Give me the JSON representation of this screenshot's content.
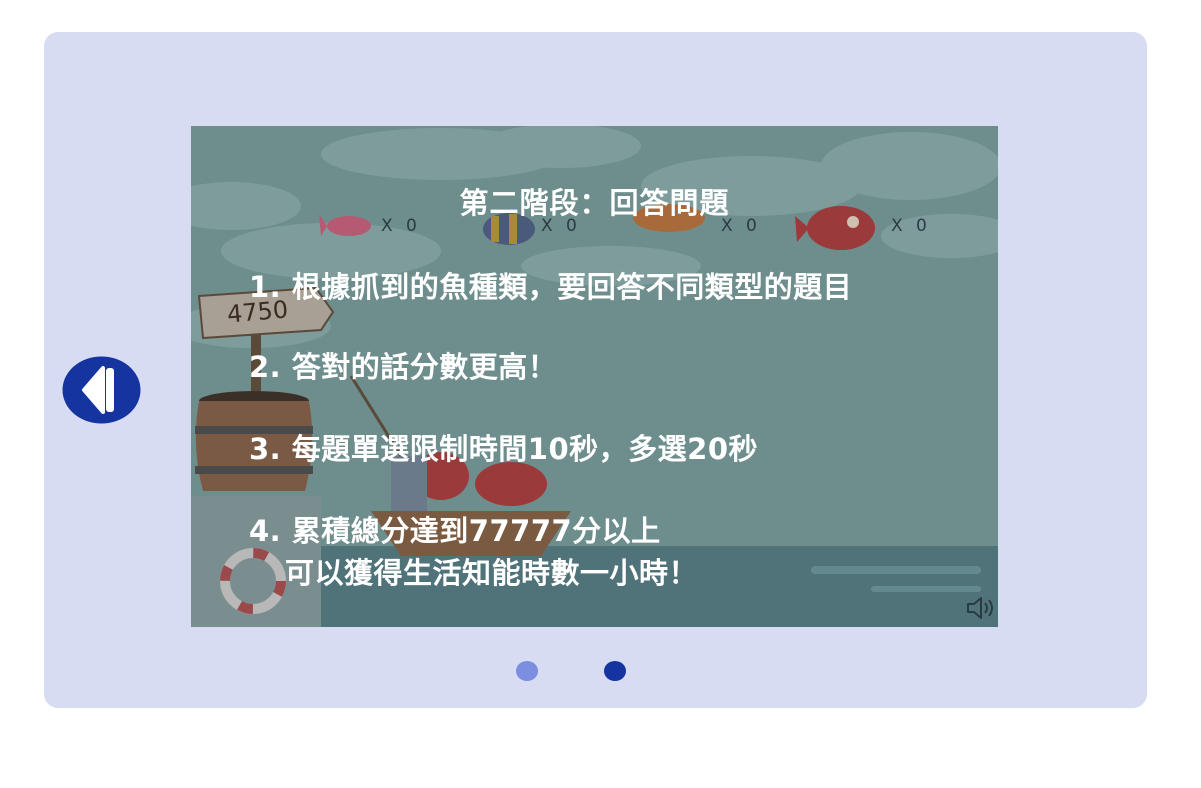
{
  "slide": {
    "title": "第二階段：回答問題",
    "rules": [
      "1. 根據抓到的魚種類，要回答不同類型的題目",
      "2. 答對的話分數更高！",
      "3. 每題單選限制時間10秒，多選20秒",
      "4. 累積總分達到77777分以上",
      "可以獲得生活知能時數一小時！"
    ]
  },
  "game": {
    "score": "4750",
    "fish_counts": [
      "X 0",
      "X 0",
      "X 0",
      "X 0"
    ]
  },
  "icons": {
    "prev": "triangle-left-icon",
    "sound": "speaker-icon"
  },
  "pager": {
    "total_pages": 2,
    "current_page": 2
  },
  "colors": {
    "panel_bg": "#d8dcf3",
    "accent": "#1534a0",
    "dot_inactive": "#7b8ee0"
  }
}
